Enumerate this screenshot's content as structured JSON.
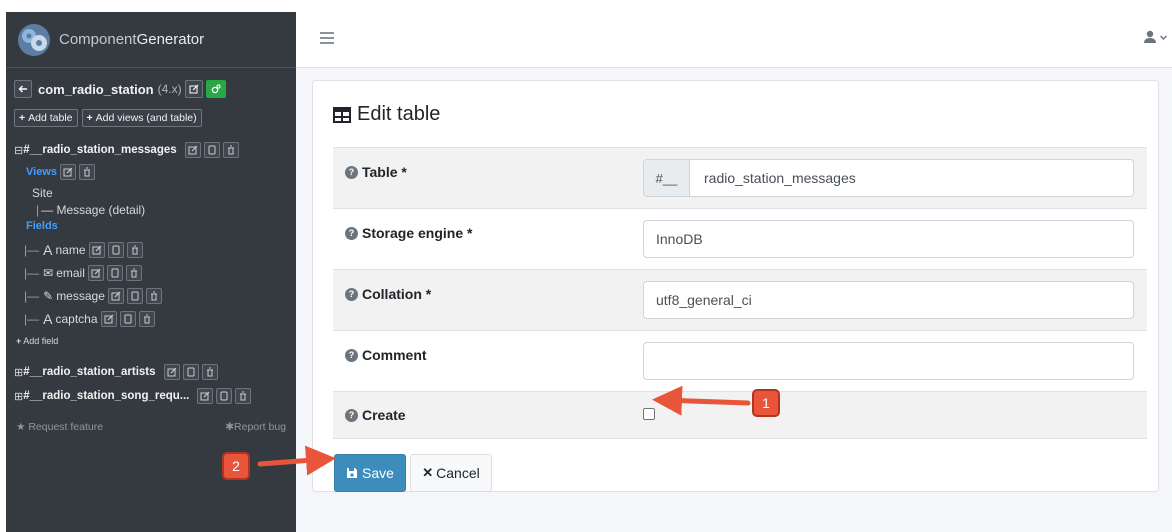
{
  "brand": {
    "part1": "Component",
    "part2": "Generator"
  },
  "sidebar": {
    "component_name": "com_radio_station",
    "component_version": "(4.x)",
    "add_table_label": "Add table",
    "add_views_label": "Add views (and table)",
    "table1": "#__radio_station_messages",
    "views_label": "Views",
    "site_label": "Site",
    "view_item": "— Message (detail)",
    "fields_label": "Fields",
    "fields": [
      {
        "glyph": "A",
        "label": "name"
      },
      {
        "glyph": "✉",
        "label": "email"
      },
      {
        "glyph": "✎",
        "label": "message"
      },
      {
        "glyph": "A",
        "label": "captcha"
      }
    ],
    "add_field_label": "Add field",
    "table2": "#__radio_station_artists",
    "table3": "#__radio_station_song_requ...",
    "request_feature": "Request feature",
    "report_bug": "Report bug"
  },
  "card": {
    "title": "Edit table",
    "fields": {
      "table": {
        "label": "Table *",
        "prefix": "#__",
        "value": "radio_station_messages"
      },
      "storage": {
        "label": "Storage engine *",
        "value": "InnoDB"
      },
      "collation": {
        "label": "Collation *",
        "value": "utf8_general_ci"
      },
      "comment": {
        "label": "Comment",
        "value": ""
      },
      "create": {
        "label": "Create",
        "checked": false
      }
    },
    "save_label": "Save",
    "cancel_label": "Cancel"
  },
  "annotations": {
    "badge1": "1",
    "badge2": "2"
  },
  "colors": {
    "primary": "#3c8dbc",
    "sidebar": "#343a40",
    "annotation": "#e8553a",
    "accent": "#28a745"
  }
}
